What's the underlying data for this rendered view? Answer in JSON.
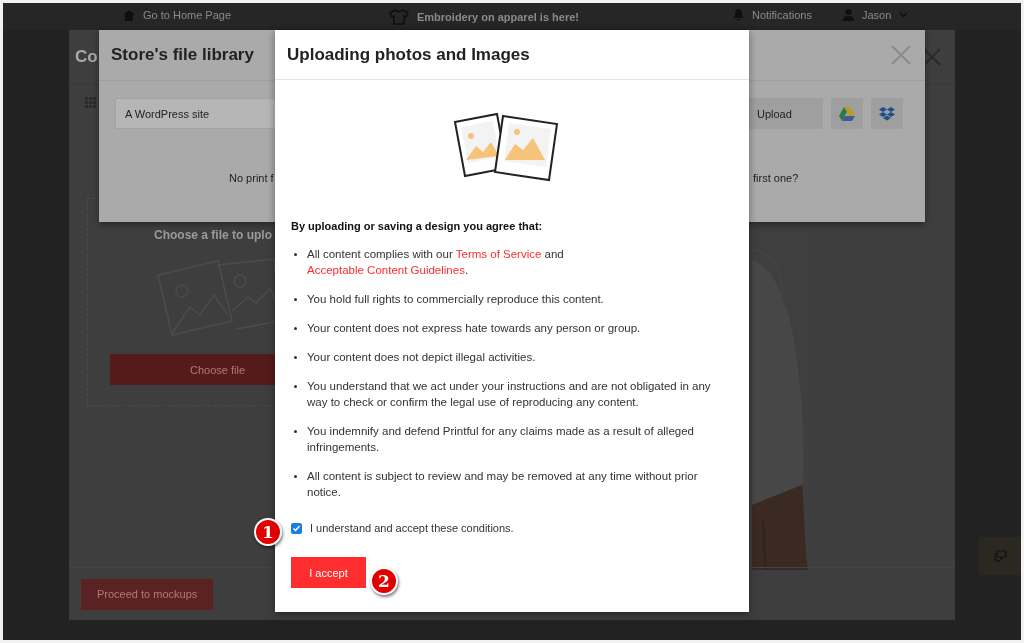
{
  "top_bar": {
    "home_link": "Go to Home Page",
    "announcement": "Embroidery on apparel is here!",
    "notifications": "Notifications",
    "user": "Jason"
  },
  "base_modal": {
    "title": "Co",
    "choose_heading": "Choose a file to uplo",
    "choose_button": "Choose file",
    "proceed_button": "Proceed to mockups"
  },
  "library_modal": {
    "title": "Store's file library",
    "source_field": {
      "value": "A WordPress site"
    },
    "upload_button": "Upload",
    "empty_text_left": "No print f",
    "empty_text_right": "first one?"
  },
  "dialog": {
    "title": "Uploading photos and Images",
    "intro": "By uploading or saving a design you agree that:",
    "items": [
      {
        "parts": [
          {
            "kind": "text",
            "text": "All content complies with our "
          },
          {
            "kind": "link",
            "text": "Terms of Service"
          },
          {
            "kind": "text",
            "text": " and "
          },
          {
            "kind": "link",
            "text": "Acceptable Content Guidelines"
          },
          {
            "kind": "text",
            "text": "."
          }
        ]
      },
      {
        "parts": [
          {
            "kind": "text",
            "text": "You hold full rights to commercially reproduce this content."
          }
        ]
      },
      {
        "parts": [
          {
            "kind": "text",
            "text": "Your content does not express hate towards any person or group."
          }
        ]
      },
      {
        "parts": [
          {
            "kind": "text",
            "text": "Your content does not depict illegal activities."
          }
        ]
      },
      {
        "parts": [
          {
            "kind": "text",
            "text": "You understand that we act under your instructions and are not obligated in any way to check or confirm the legal use of reproducing any content."
          }
        ]
      },
      {
        "parts": [
          {
            "kind": "text",
            "text": "You indemnify and defend Printful for any claims made as a result of alleged infringements."
          }
        ]
      },
      {
        "parts": [
          {
            "kind": "text",
            "text": "All content is subject to review and may be removed at any time without prior notice."
          }
        ]
      }
    ],
    "accept_checkbox": {
      "label": "I understand and accept these conditions.",
      "checked": true
    },
    "accept_button": "I accept"
  },
  "annotations": [
    {
      "label": "1"
    },
    {
      "label": "2"
    }
  ]
}
